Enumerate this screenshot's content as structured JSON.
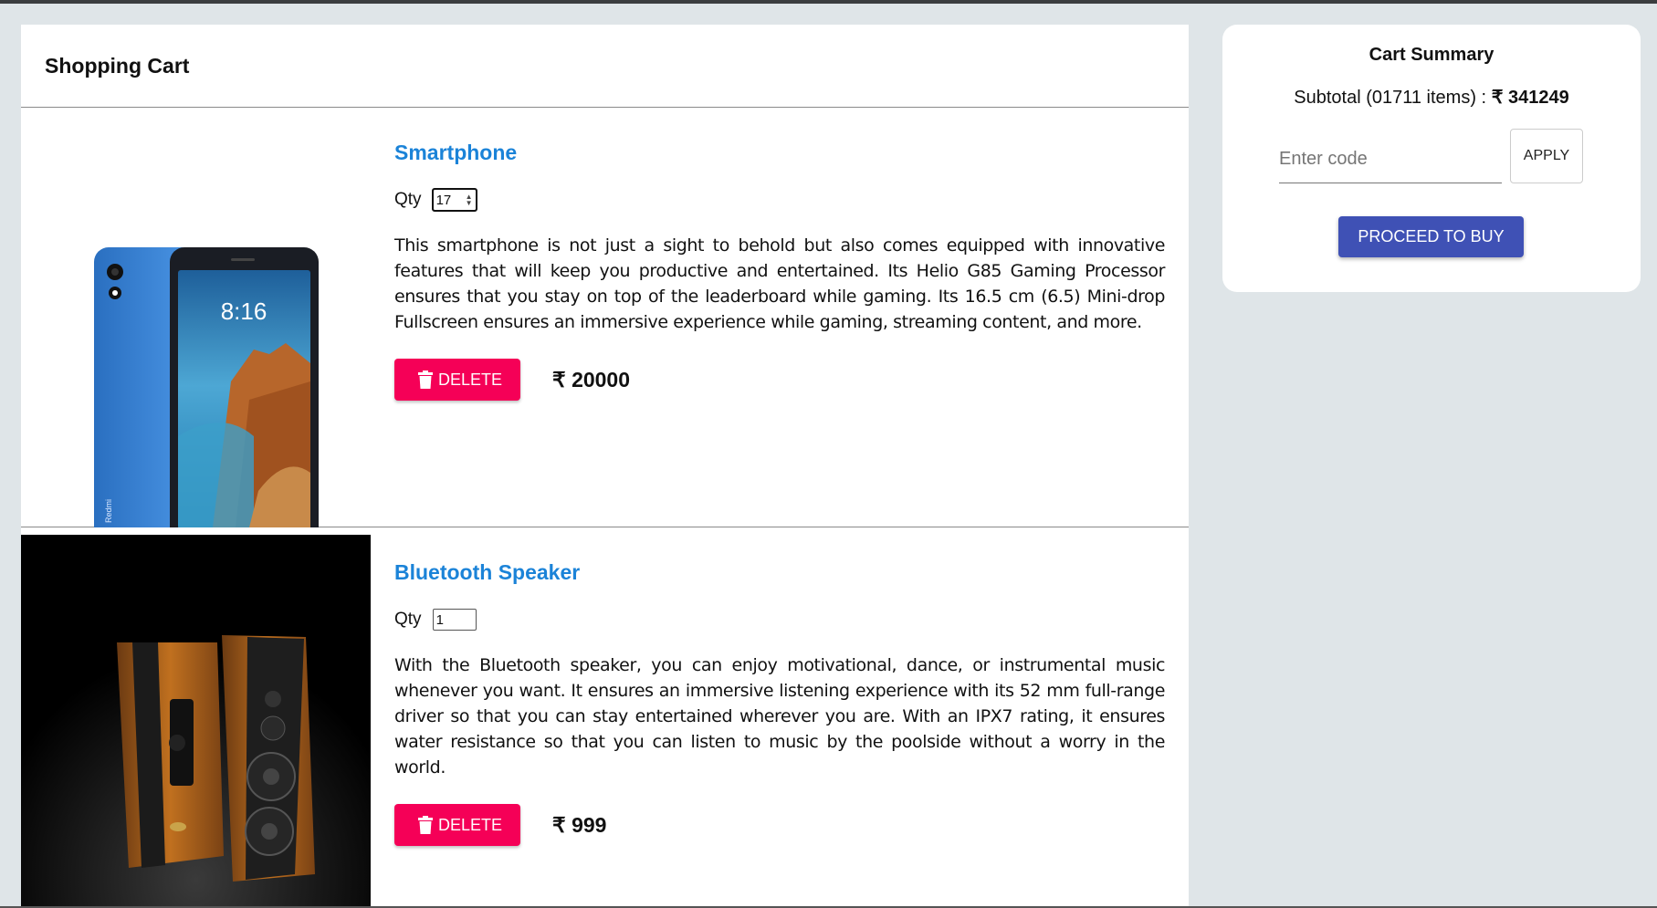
{
  "cart": {
    "title": "Shopping Cart",
    "currency_symbol": "₹",
    "items": [
      {
        "name": "Smartphone",
        "qty_label": "Qty",
        "qty": "17",
        "description": "This smartphone is not just a sight to behold but also comes equipped with innovative features that will keep you productive and entertained. Its Helio G85 Gaming Processor ensures that you stay on top of the leaderboard while gaming. Its 16.5 cm (6.5) Mini-drop Fullscreen ensures an immersive experience while gaming, streaming content, and more.",
        "delete_label": "DELETE",
        "price": "20000",
        "phone_time": "8:16",
        "phone_brand": "Redmi"
      },
      {
        "name": "Bluetooth Speaker",
        "qty_label": "Qty",
        "qty": "1",
        "description": "With the Bluetooth speaker, you can enjoy motivational, dance, or instrumental music whenever you want. It ensures an immersive listening experience with its 52 mm full-range driver so that you can stay entertained wherever you are. With an IPX7 rating, it ensures water resistance so that you can listen to music by the poolside without a worry in the world.",
        "delete_label": "DELETE",
        "price": "999"
      }
    ]
  },
  "summary": {
    "title": "Cart Summary",
    "subtotal_label": "Subtotal (01711 items) :",
    "subtotal_value": "₹ 341249",
    "coupon_placeholder": "Enter code",
    "apply_label": "APPLY",
    "buy_label": "PROCEED TO BUY"
  },
  "colors": {
    "background": "#dfe5e8",
    "product_name": "#1b83d8",
    "delete_button": "#f50057",
    "buy_button": "#3f51b5"
  },
  "icons": [
    "trash-icon",
    "spinner-arrows-icon"
  ]
}
